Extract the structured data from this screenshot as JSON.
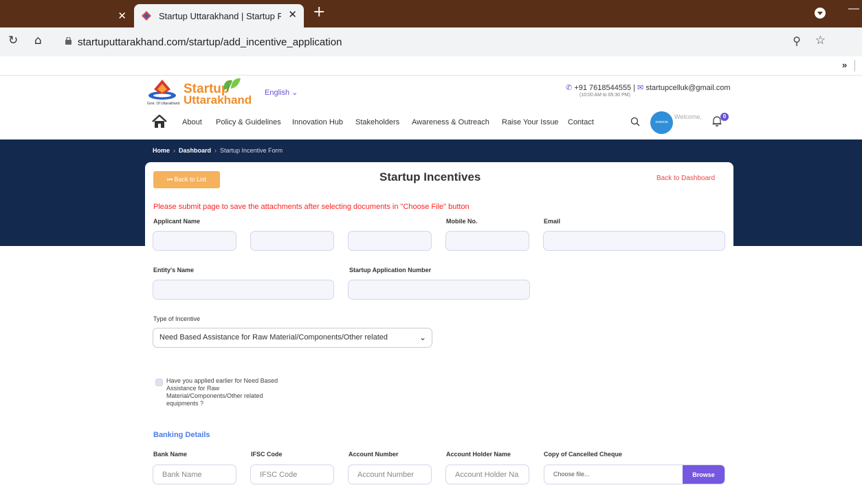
{
  "browser": {
    "tab_title": "Startup Uttarakhand | Startup Rec",
    "url": "startuputtarakhand.com/startup/add_incentive_application",
    "bookmark_more": "»"
  },
  "header": {
    "brand_line1": "Startup",
    "brand_line2": "Uttarakhand",
    "emblem_caption": "Govt. Of Uttarakhand",
    "language": "English ⌄",
    "phone": "+91 7618544555",
    "email": "startupcelluk@gmail.com",
    "hours": "(10:00 AM to 05:30 PM)",
    "nav": [
      "About",
      "Policy & Guidelines",
      "Innovation Hub",
      "Stakeholders",
      "Awareness & Outreach",
      "Raise Your Issue",
      "Contact"
    ],
    "welcome": "Welcome,",
    "avatar_text": "sciencia",
    "notification_count": "0"
  },
  "breadcrumb": {
    "home": "Home",
    "dashboard": "Dashboard",
    "current": "Startup Incentive Form"
  },
  "form": {
    "back_to_list": "⏮ Back to List",
    "title": "Startup Incentives",
    "back_to_dashboard": "Back to Dashboard",
    "warning": "Please submit page to save the attachments after selecting documents in \"Choose File\" button",
    "labels": {
      "applicant_name": "Applicant Name",
      "mobile": "Mobile No.",
      "email": "Email",
      "entity_name": "Entity's Name",
      "startup_app_no": "Startup Application Number",
      "type_of_incentive": "Type of Incentive"
    },
    "incentive_selected": "Need Based Assistance for Raw Material/Components/Other related",
    "checkbox_label": "Have you applied earlier for Need Based Assistance for Raw Material/Components/Other related equipments ?",
    "banking": {
      "section_title": "Banking Details",
      "bank_name_label": "Bank Name",
      "ifsc_label": "IFSC Code",
      "account_number_label": "Account Number",
      "holder_label": "Account Holder Name",
      "cheque_label": "Copy of Cancelled Cheque",
      "bank_name_placeholder": "Bank Name",
      "ifsc_placeholder": "IFSC Code",
      "account_number_placeholder": "Account Number",
      "holder_placeholder": "Account Holder Na",
      "choose_file": "Choose file...",
      "browse": "Browse"
    }
  },
  "colors": {
    "tabbar": "#5a2f17",
    "hero": "#13294e",
    "brand_orange": "#f28c28",
    "accent_purple": "#7557e0",
    "warning_red": "#ff2020",
    "section_blue": "#4b7ce8"
  }
}
